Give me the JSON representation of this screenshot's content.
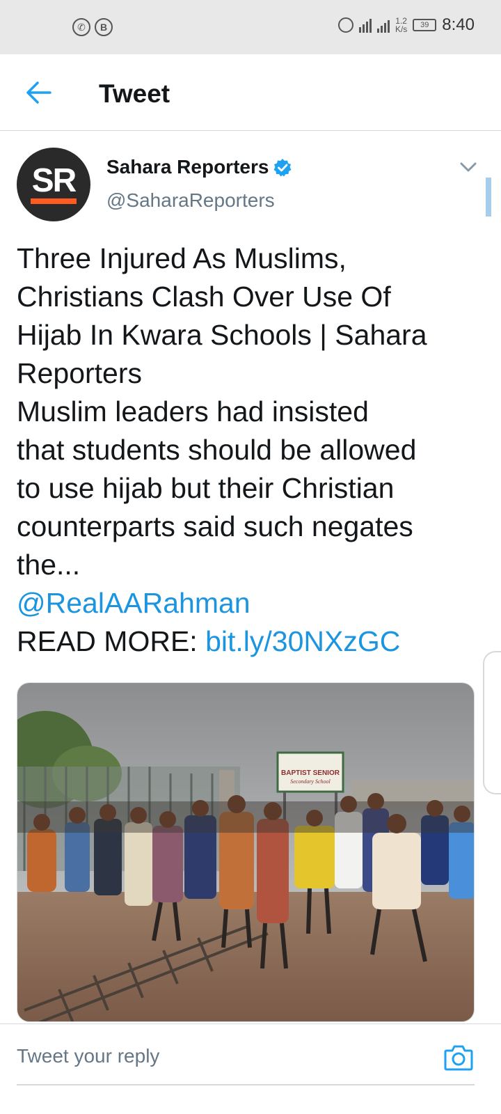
{
  "status_bar": {
    "left_icons": [
      "whatsapp-icon",
      "b-icon"
    ],
    "speed_top": "1.2",
    "speed_bottom": "K/s",
    "battery": "39",
    "time": "8:40"
  },
  "header": {
    "title": "Tweet"
  },
  "tweet": {
    "author_name": "Sahara Reporters",
    "author_handle": "@SaharaReporters",
    "avatar_text": "SR",
    "lines": [
      "Three Injured As Muslims,",
      "Christians Clash Over Use Of",
      "Hijab In Kwara Schools | Sahara",
      "Reporters",
      "Muslim leaders had insisted",
      "that students should be allowed",
      "to use hijab but their Christian",
      "counterparts said such negates",
      "the..."
    ],
    "mention": "@RealAARahman",
    "read_more_label": "READ MORE: ",
    "read_more_link": "bit.ly/30NXzGC",
    "photo_sign_line1": "BAPTIST SENIOR",
    "photo_sign_line2": "Secondary School"
  },
  "reply": {
    "placeholder": "Tweet your reply"
  },
  "colors": {
    "link": "#1b95e0",
    "accent_brand": "#ff5a1f",
    "verified": "#1da1f2"
  }
}
